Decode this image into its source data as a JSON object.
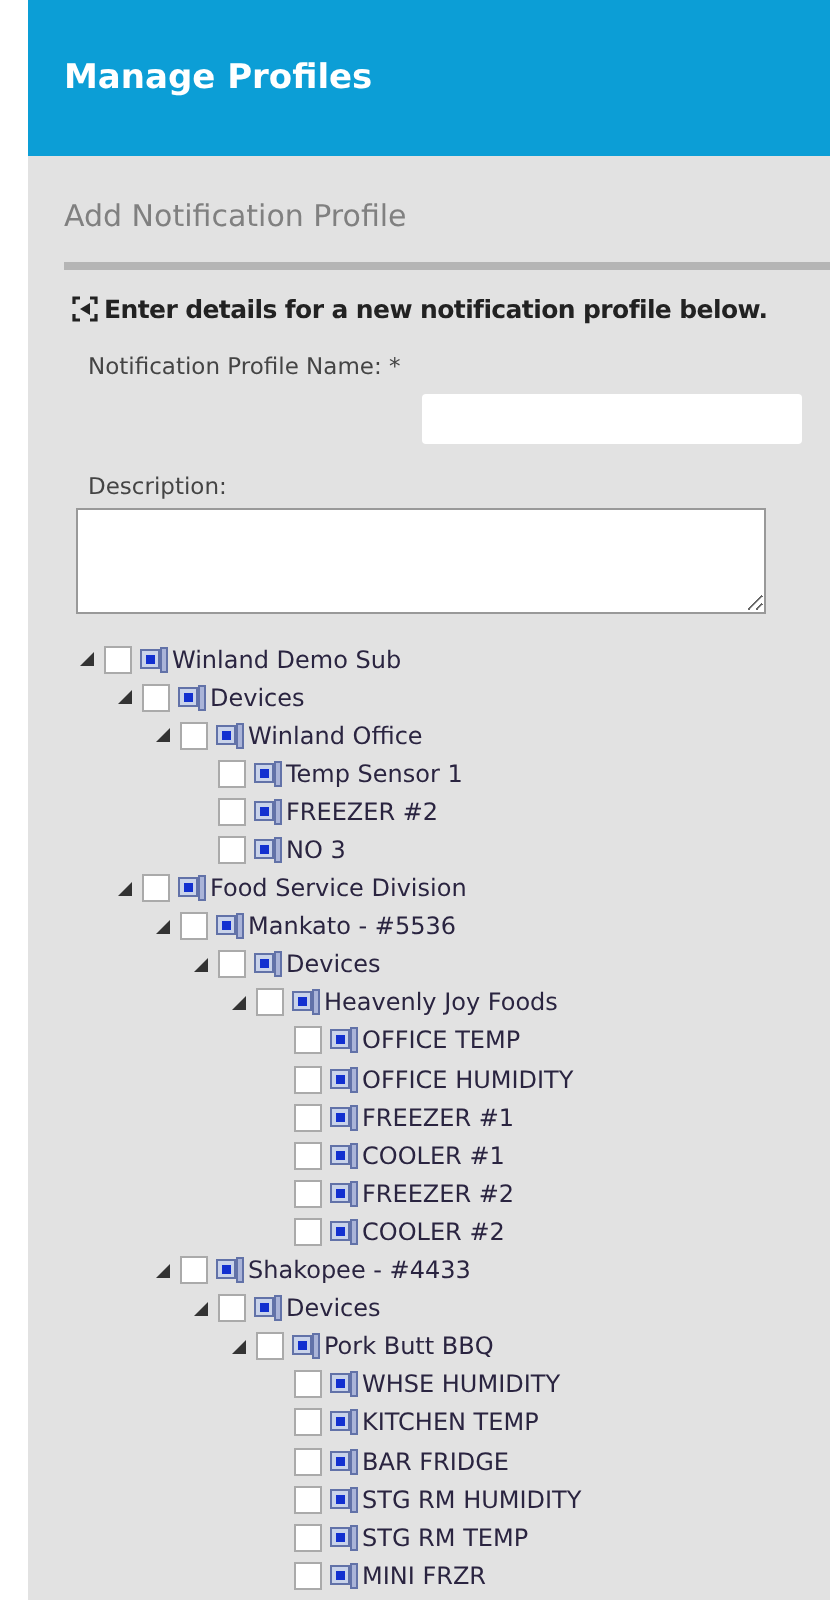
{
  "header": {
    "title": "Manage Profiles"
  },
  "section": {
    "title": "Add Notification Profile"
  },
  "instruction": "Enter details for a new notification profile below.",
  "form": {
    "name_label": "Notification Profile Name: *",
    "description_label": "Description:"
  },
  "tree": [
    {
      "label": "Winland Demo Sub",
      "checked": false,
      "expanded": true,
      "children": [
        {
          "label": "Devices",
          "checked": false,
          "expanded": true,
          "children": [
            {
              "label": "Winland Office",
              "checked": false,
              "expanded": true,
              "children": [
                {
                  "label": "Temp Sensor 1",
                  "checked": false
                },
                {
                  "label": "FREEZER #2",
                  "checked": false
                },
                {
                  "label": "NO 3",
                  "checked": false
                }
              ]
            }
          ]
        },
        {
          "label": "Food Service Division",
          "checked": false,
          "expanded": true,
          "children": [
            {
              "label": "Mankato - #5536",
              "checked": false,
              "expanded": true,
              "children": [
                {
                  "label": "Devices",
                  "checked": false,
                  "expanded": true,
                  "children": [
                    {
                      "label": "Heavenly Joy Foods",
                      "checked": false,
                      "expanded": true,
                      "children": [
                        {
                          "label": "OFFICE TEMP",
                          "checked": false
                        },
                        {
                          "label": "OFFICE HUMIDITY",
                          "checked": false
                        },
                        {
                          "label": "FREEZER #1",
                          "checked": false
                        },
                        {
                          "label": "COOLER #1",
                          "checked": false
                        },
                        {
                          "label": "FREEZER #2",
                          "checked": false
                        },
                        {
                          "label": "COOLER #2",
                          "checked": false
                        }
                      ]
                    }
                  ]
                }
              ]
            },
            {
              "label": "Shakopee - #4433",
              "checked": false,
              "expanded": true,
              "children": [
                {
                  "label": "Devices",
                  "checked": false,
                  "expanded": true,
                  "children": [
                    {
                      "label": "Pork Butt BBQ",
                      "checked": false,
                      "expanded": true,
                      "children": [
                        {
                          "label": "WHSE HUMIDITY",
                          "checked": false
                        },
                        {
                          "label": "KITCHEN TEMP",
                          "checked": false
                        },
                        {
                          "label": "BAR FRIDGE",
                          "checked": false
                        },
                        {
                          "label": "STG RM HUMIDITY",
                          "checked": false
                        },
                        {
                          "label": "STG RM TEMP",
                          "checked": false
                        },
                        {
                          "label": "MINI FRZR",
                          "checked": false
                        }
                      ]
                    }
                  ]
                }
              ]
            }
          ]
        }
      ]
    }
  ]
}
